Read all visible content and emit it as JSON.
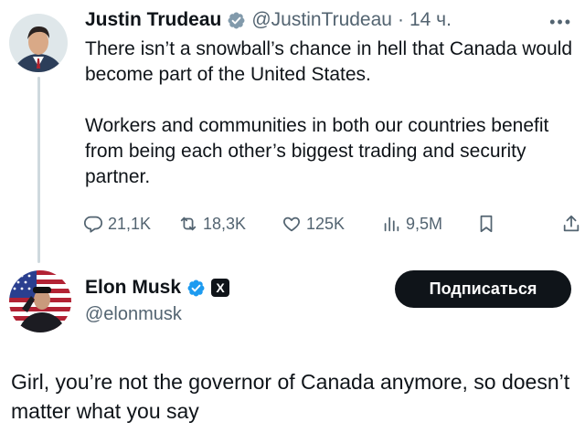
{
  "reply_tweet": {
    "author": {
      "name": "Justin Trudeau",
      "handle": "@JustinTrudeau",
      "separator": "·",
      "time": "14 ч.",
      "verified": "gov-gray-check-icon"
    },
    "text_paragraphs": [
      "There isn’t a snowball’s chance in hell that Canada would become part of the United States.",
      "Workers and communities in both our countries benefit from being each other’s biggest trading and security partner."
    ],
    "stats": {
      "replies": "21,1K",
      "reposts": "18,3K",
      "likes": "125K",
      "views": "9,5M"
    }
  },
  "main_tweet": {
    "author": {
      "name": "Elon Musk",
      "handle": "@elonmusk",
      "verified": "blue-check-icon",
      "affiliate_badge": "X"
    },
    "follow_label": "Подписаться",
    "text": "Girl, you’re not the governor of Canada anymore, so doesn’t matter what you say"
  },
  "colors": {
    "text": "#0f1419",
    "muted": "#536471",
    "verified_blue": "#1d9bf0",
    "gov_gray": "#829aab",
    "button": "#0f1419"
  }
}
